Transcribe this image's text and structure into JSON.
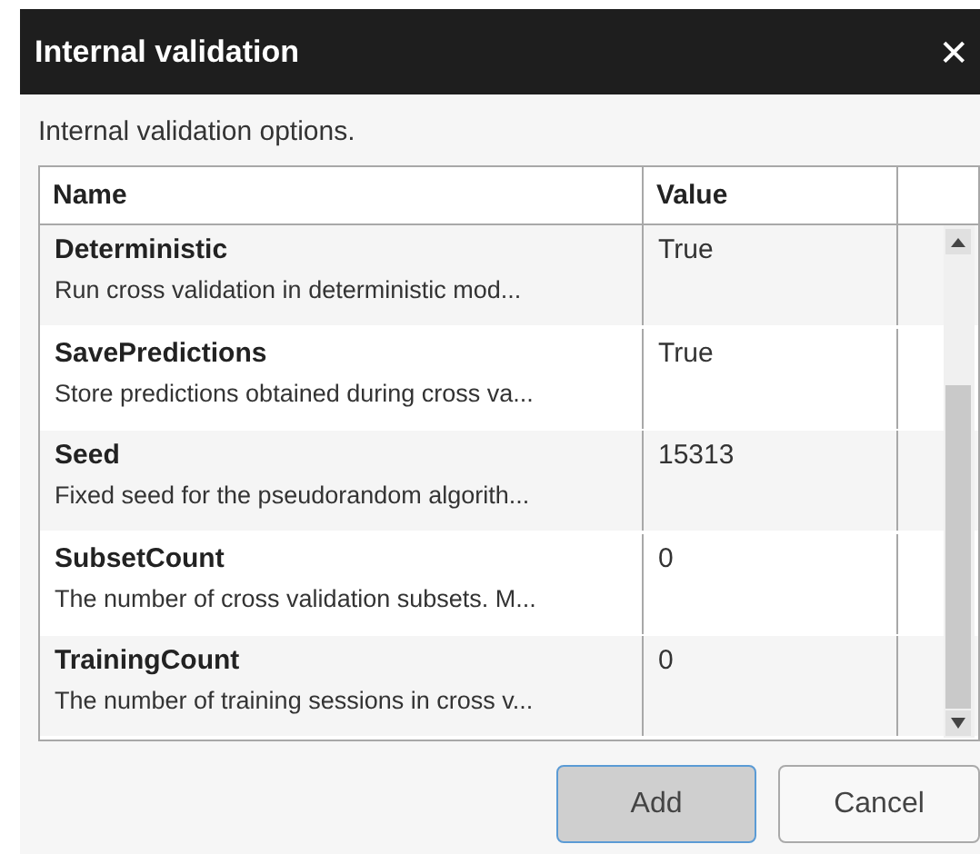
{
  "window": {
    "title": "Internal validation",
    "close": "✕"
  },
  "description": "Internal validation options.",
  "table": {
    "columns": [
      "Name",
      "Value"
    ],
    "rows": [
      {
        "name": "Deterministic",
        "description": "Run cross validation in deterministic mod...",
        "value": "True"
      },
      {
        "name": "SavePredictions",
        "description": "Store predictions obtained during cross va...",
        "value": "True"
      },
      {
        "name": "Seed",
        "description": "Fixed seed for the pseudorandom algorith...",
        "value": "15313"
      },
      {
        "name": "SubsetCount",
        "description": "The number of cross validation subsets. M...",
        "value": "0"
      },
      {
        "name": "TrainingCount",
        "description": "The number of training sessions in cross v...",
        "value": "0"
      }
    ]
  },
  "buttons": [
    {
      "label": "Add",
      "focused": true
    },
    {
      "label": "Cancel",
      "focused": false
    }
  ]
}
